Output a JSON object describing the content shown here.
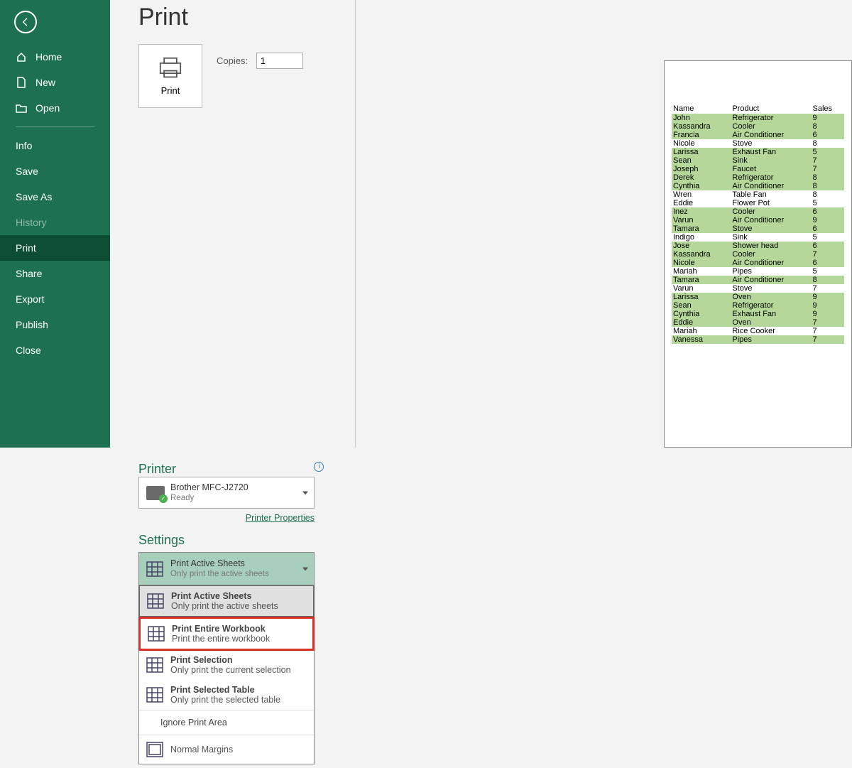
{
  "title": "Print",
  "sidebar": {
    "top": [
      {
        "label": "Home"
      },
      {
        "label": "New"
      },
      {
        "label": "Open"
      }
    ],
    "bottom": [
      {
        "label": "Info"
      },
      {
        "label": "Save"
      },
      {
        "label": "Save As"
      },
      {
        "label": "History",
        "dim": true
      },
      {
        "label": "Print",
        "active": true
      },
      {
        "label": "Share"
      },
      {
        "label": "Export"
      },
      {
        "label": "Publish"
      },
      {
        "label": "Close"
      }
    ]
  },
  "print_button": "Print",
  "copies_label": "Copies:",
  "copies_value": "1",
  "printer_section": "Printer",
  "printer": {
    "name": "Brother MFC-J2720",
    "status": "Ready"
  },
  "printer_props": "Printer Properties",
  "settings_section": "Settings",
  "selected": {
    "title": "Print Active Sheets",
    "sub": "Only print the active sheets"
  },
  "options": [
    {
      "title": "Print Active Sheets",
      "sub": "Only print the active sheets",
      "sel": true
    },
    {
      "title": "Print Entire Workbook",
      "sub": "Print the entire workbook",
      "hl": true
    },
    {
      "title": "Print Selection",
      "sub": "Only print the current selection"
    },
    {
      "title": "Print Selected Table",
      "sub": "Only print the selected table"
    }
  ],
  "ignore": "Ignore Print Area",
  "margins": "Normal Margins",
  "preview": {
    "headers": [
      "Name",
      "Product",
      "Sales"
    ],
    "rows": [
      {
        "g": 1,
        "c": [
          "John",
          "Refrigerator",
          "9"
        ]
      },
      {
        "g": 1,
        "c": [
          "Kassandra",
          "Cooler",
          "8"
        ]
      },
      {
        "g": 1,
        "c": [
          "Francia",
          "Air Conditioner",
          "6"
        ]
      },
      {
        "g": 0,
        "c": [
          "Nicole",
          "Stove",
          "8"
        ]
      },
      {
        "g": 1,
        "c": [
          "Larissa",
          "Exhaust Fan",
          "5"
        ]
      },
      {
        "g": 1,
        "c": [
          "Sean",
          "Sink",
          "7"
        ]
      },
      {
        "g": 1,
        "c": [
          "Joseph",
          "Faucet",
          "7"
        ]
      },
      {
        "g": 1,
        "c": [
          "Derek",
          "Refrigerator",
          "8"
        ]
      },
      {
        "g": 1,
        "c": [
          "Cynthia",
          "Air Conditioner",
          "8"
        ]
      },
      {
        "g": 0,
        "c": [
          "Wren",
          "Table Fan",
          "8"
        ]
      },
      {
        "g": 0,
        "c": [
          "Eddie",
          "Flower Pot",
          "5"
        ]
      },
      {
        "g": 1,
        "c": [
          "Inez",
          "Cooler",
          "6"
        ]
      },
      {
        "g": 1,
        "c": [
          "Varun",
          "Air Conditioner",
          "9"
        ]
      },
      {
        "g": 1,
        "c": [
          "Tamara",
          "Stove",
          "6"
        ]
      },
      {
        "g": 0,
        "c": [
          "Indigo",
          "Sink",
          "5"
        ]
      },
      {
        "g": 1,
        "c": [
          "Jose",
          "Shower head",
          "6"
        ]
      },
      {
        "g": 1,
        "c": [
          "Kassandra",
          "Cooler",
          "7"
        ]
      },
      {
        "g": 1,
        "c": [
          "Nicole",
          "Air Conditioner",
          "6"
        ]
      },
      {
        "g": 0,
        "c": [
          "Mariah",
          "Pipes",
          "5"
        ]
      },
      {
        "g": 1,
        "c": [
          "Tamara",
          "Air Conditioner",
          "8"
        ]
      },
      {
        "g": 0,
        "c": [
          "Varun",
          "Stove",
          "7"
        ]
      },
      {
        "g": 1,
        "c": [
          "Larissa",
          "Oven",
          "9"
        ]
      },
      {
        "g": 1,
        "c": [
          "Sean",
          "Refrigerator",
          "9"
        ]
      },
      {
        "g": 1,
        "c": [
          "Cynthia",
          "Exhaust Fan",
          "9"
        ]
      },
      {
        "g": 1,
        "c": [
          "Eddie",
          "Oven",
          "7"
        ]
      },
      {
        "g": 0,
        "c": [
          "Mariah",
          "Rice Cooker",
          "7"
        ]
      },
      {
        "g": 1,
        "c": [
          "Vanessa",
          "Pipes",
          "7"
        ]
      }
    ]
  }
}
